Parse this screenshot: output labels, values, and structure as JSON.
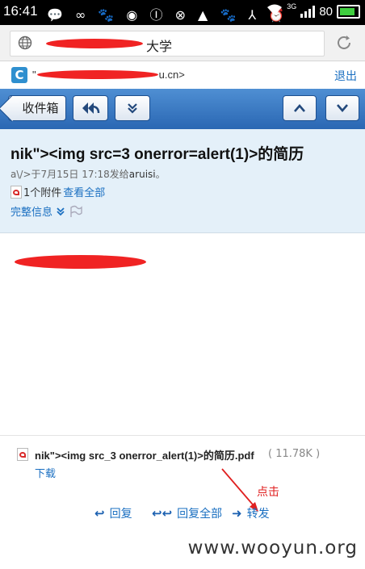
{
  "status_bar": {
    "time": "16:41",
    "icons": "💬 ∞ 🐾 ◉ Ⓘ ⊗ ▲ 🐾 ⅄ ⏰",
    "network_tag": "3G",
    "battery": "80"
  },
  "browser": {
    "url_suffix": "大学"
  },
  "app": {
    "account": "\"",
    "account_suffix": "u.cn>",
    "logout": "退出"
  },
  "toolbar": {
    "inbox": "收件箱",
    "reply_icon": "↩",
    "more_icon": "⌄⌄",
    "up_icon": "⌃",
    "down_icon": "⌄"
  },
  "mail": {
    "subject": "nik\"><img src=3 onerror=alert(1)>的简历",
    "sender_prefix": "a\\/>于7月15日 17:18发给",
    "recipient": "aruisi",
    "sender_suffix": "。",
    "attach_count": "1个附件",
    "view_all": "查看全部",
    "full_info": "完整信息"
  },
  "attachment": {
    "name": "nik\"><img src_3 onerror_alert(1)>的简历.pdf",
    "size": "( 11.78K )",
    "download": "下载"
  },
  "actions": {
    "reply": "回复",
    "reply_all": "回复全部",
    "forward": "转发"
  },
  "annotation": "点击",
  "watermark": "www.wooyun.org",
  "colors": {
    "toolbar_blue": "#3a78c4",
    "header_bg": "#e4f0f9",
    "link": "#1a6fc1",
    "redact": "#f02323"
  }
}
